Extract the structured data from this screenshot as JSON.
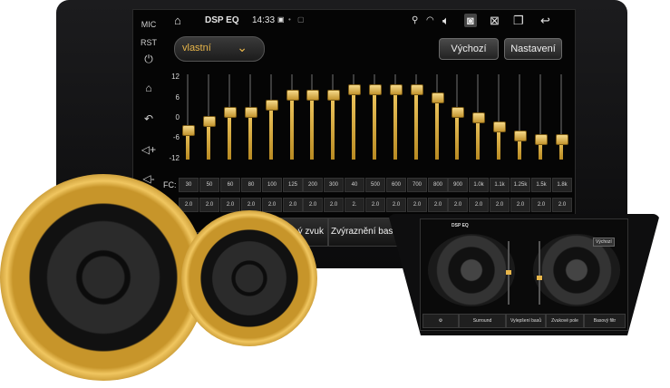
{
  "side": {
    "mic": "MIC",
    "rst": "RST",
    "icons": [
      "power-icon",
      "home-icon",
      "back-icon",
      "volume-up-icon",
      "volume-down-icon"
    ]
  },
  "status": {
    "title": "DSP EQ",
    "time": "14:33"
  },
  "preset": {
    "selected": "vlastní"
  },
  "buttons": {
    "default": "Výchozí",
    "settings": "Nastavení"
  },
  "axis": [
    "12",
    "6",
    "0",
    "-6",
    "-12"
  ],
  "eq": {
    "fc_label": "FC:",
    "bands": [
      {
        "freq": "30",
        "q": "2.0",
        "gain": -3.5
      },
      {
        "freq": "50",
        "q": "2.0",
        "gain": -1
      },
      {
        "freq": "60",
        "q": "2.0",
        "gain": 1.5
      },
      {
        "freq": "80",
        "q": "2.0",
        "gain": 1.5
      },
      {
        "freq": "100",
        "q": "2.0",
        "gain": 3.5
      },
      {
        "freq": "125",
        "q": "2.0",
        "gain": 6.5
      },
      {
        "freq": "200",
        "q": "2.0",
        "gain": 6.5
      },
      {
        "freq": "300",
        "q": "2.0",
        "gain": 6.5
      },
      {
        "freq": "40",
        "q": "2.",
        "gain": 8
      },
      {
        "freq": "500",
        "q": "2.0",
        "gain": 8
      },
      {
        "freq": "600",
        "q": "2.0",
        "gain": 8
      },
      {
        "freq": "700",
        "q": "2.0",
        "gain": 8
      },
      {
        "freq": "800",
        "q": "2.0",
        "gain": 5.5
      },
      {
        "freq": "900",
        "q": "2.0",
        "gain": 1.5
      },
      {
        "freq": "1.0k",
        "q": "2.0",
        "gain": 0
      },
      {
        "freq": "1.1k",
        "q": "2.0",
        "gain": -2.5
      },
      {
        "freq": "1.25k",
        "q": "2.0",
        "gain": -5
      },
      {
        "freq": "1.5k",
        "q": "2.0",
        "gain": -6
      },
      {
        "freq": "1.8k",
        "q": "2.0",
        "gain": -6
      }
    ]
  },
  "bottom": {
    "b1": "ý zvuk",
    "b2": "Zvýraznění basů"
  },
  "unit2": {
    "title": "DSP EQ",
    "default": "Výchozí",
    "buttons": [
      "Surround",
      "Vylepšení basů",
      "Zvukové pole",
      "Basový filtr"
    ]
  },
  "colors": {
    "gold": "#e8b64a",
    "dark": "#050505"
  }
}
